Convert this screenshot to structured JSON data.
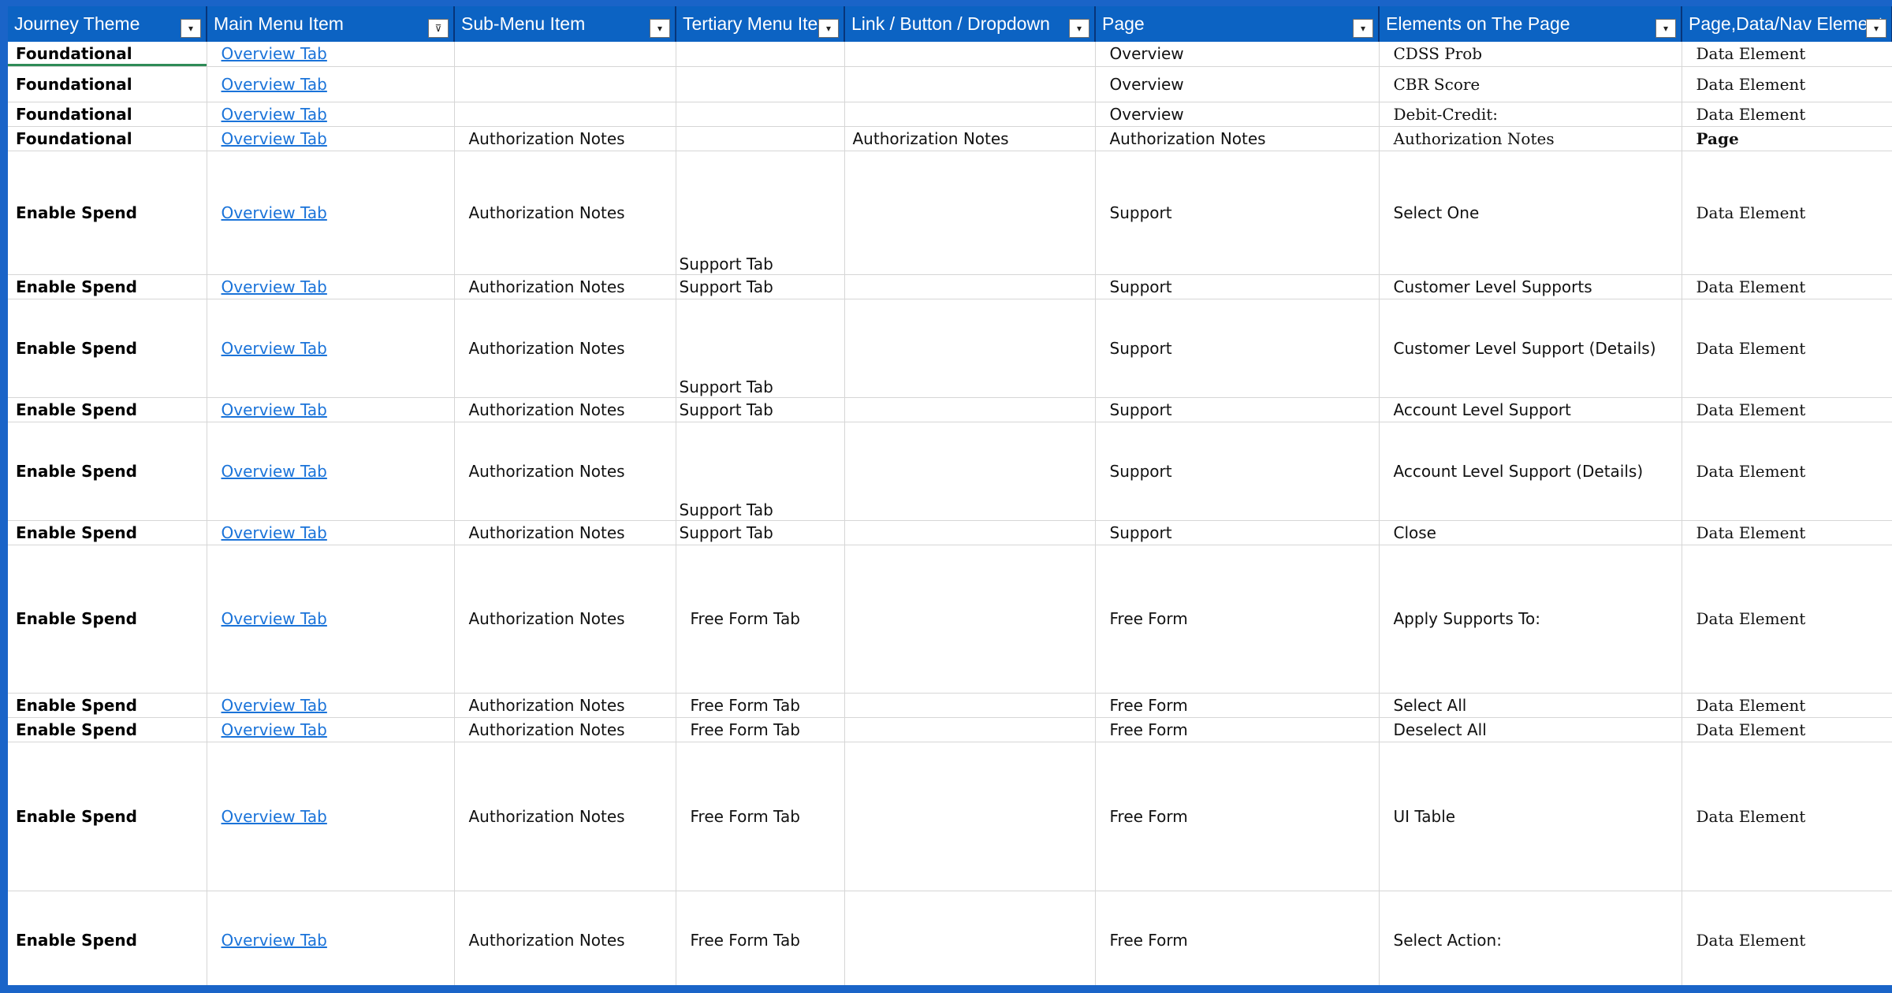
{
  "columns": [
    {
      "label": "Journey Theme",
      "filter": "dropdown"
    },
    {
      "label": "Main Menu Item",
      "filter": "filtered"
    },
    {
      "label": "Sub-Menu Item",
      "filter": "dropdown"
    },
    {
      "label": "Tertiary Menu Item",
      "filter": "dropdown"
    },
    {
      "label": "Link / Button / Dropdown",
      "filter": "dropdown"
    },
    {
      "label": "Page",
      "filter": "dropdown"
    },
    {
      "label": "Elements on The Page",
      "filter": "dropdown"
    },
    {
      "label": "Page,Data/Nav Element",
      "filter": "dropdown"
    }
  ],
  "rows": [
    [
      "Foundational",
      "Overview Tab",
      "",
      "",
      "",
      "Overview",
      "CDSS Prob",
      "Data Element"
    ],
    [
      "Foundational",
      "Overview Tab",
      "",
      "",
      "",
      "Overview",
      "CBR Score",
      "Data Element"
    ],
    [
      "Foundational",
      "Overview Tab",
      "",
      "",
      "",
      "Overview",
      "Debit-Credit:",
      "Data Element"
    ],
    [
      "Foundational",
      "Overview Tab",
      "Authorization Notes",
      "",
      "Authorization Notes",
      "Authorization Notes",
      "Authorization Notes",
      "Page"
    ],
    [
      "Enable Spend",
      "Overview Tab",
      "Authorization Notes",
      "Support Tab",
      "",
      "Support",
      "Select One",
      "Data Element"
    ],
    [
      "Enable Spend",
      "Overview Tab",
      "Authorization Notes",
      "Support Tab",
      "",
      "Support",
      "Customer Level Supports",
      "Data Element"
    ],
    [
      "Enable Spend",
      "Overview Tab",
      "Authorization Notes",
      "Support Tab",
      "",
      "Support",
      "Customer Level Support (Details)",
      "Data Element"
    ],
    [
      "Enable Spend",
      "Overview Tab",
      "Authorization Notes",
      "Support Tab",
      "",
      "Support",
      "Account Level Support",
      "Data Element"
    ],
    [
      "Enable Spend",
      "Overview Tab",
      "Authorization Notes",
      "Support Tab",
      "",
      "Support",
      "Account Level Support (Details)",
      "Data Element"
    ],
    [
      "Enable Spend",
      "Overview Tab",
      "Authorization Notes",
      "Support Tab",
      "",
      "Support",
      "Close",
      "Data Element"
    ],
    [
      "Enable Spend",
      "Overview Tab",
      "Authorization Notes",
      "Free Form Tab",
      "",
      "Free Form",
      "Apply Supports To:",
      "Data Element"
    ],
    [
      "Enable Spend",
      "Overview Tab",
      "Authorization Notes",
      "Free Form Tab",
      "",
      "Free Form",
      "Select All",
      "Data Element"
    ],
    [
      "Enable Spend",
      "Overview Tab",
      "Authorization Notes",
      "Free Form Tab",
      "",
      "Free Form",
      "Deselect All",
      "Data Element"
    ],
    [
      "Enable Spend",
      "Overview Tab",
      "Authorization Notes",
      "Free Form Tab",
      "",
      "Free Form",
      "UI Table",
      "Data Element"
    ],
    [
      "Enable Spend",
      "Overview Tab",
      "Authorization Notes",
      "Free Form Tab",
      "",
      "Free Form",
      "Select Action:",
      "Data Element"
    ]
  ],
  "colors": {
    "header_bg": "#0c63c3",
    "link": "#1a73d9",
    "frame": "#1a64c8"
  }
}
